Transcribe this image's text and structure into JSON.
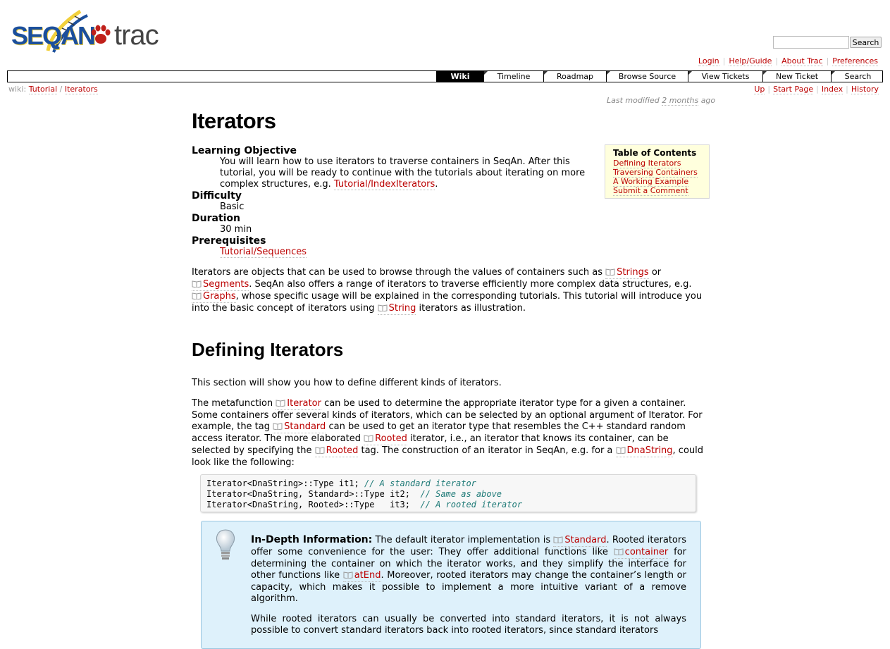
{
  "logo": {
    "brand": "SEQAN",
    "product": "trac"
  },
  "search": {
    "placeholder": "",
    "button": "Search"
  },
  "metanav": [
    "Login",
    "Help/Guide",
    "About Trac",
    "Preferences"
  ],
  "mainnav": [
    "Wiki",
    "Timeline",
    "Roadmap",
    "Browse Source",
    "View Tickets",
    "New Ticket",
    "Search"
  ],
  "breadcrumb": {
    "prefix": "wiki:",
    "items": [
      "Tutorial",
      "Iterators"
    ],
    "sep": "/"
  },
  "ctxtnav": [
    "Up",
    "Start Page",
    "Index",
    "History"
  ],
  "lastmod": {
    "prefix": "Last modified",
    "age": "2 months",
    "suffix": "ago"
  },
  "page": {
    "title": "Iterators",
    "definitions": [
      {
        "term": "Learning Objective",
        "text_before": "You will learn how to use iterators to traverse containers in SeqAn. After this tutorial, you will be ready to continue with the tutorials about iterating on more complex structures, e.g.",
        "link": "Tutorial/IndexIterators",
        "text_after": "."
      },
      {
        "term": "Difficulty",
        "text": "Basic"
      },
      {
        "term": "Duration",
        "text": "30 min"
      },
      {
        "term": "Prerequisites",
        "link": "Tutorial/Sequences"
      }
    ],
    "toc": {
      "title": "Table of Contents",
      "items": [
        "Defining Iterators",
        "Traversing Containers",
        "A Working Example",
        "Submit a Comment"
      ]
    },
    "intro": {
      "t1": "Iterators are objects that can be used to browse through the values of containers such as",
      "l1": "Strings",
      "t2": "or",
      "l2": "Segments",
      "t3": ". SeqAn also offers a range of iterators to traverse efficiently more complex data structures, e.g.",
      "l3": "Graphs",
      "t4": ", whose specific usage will be explained in the corresponding tutorials. This tutorial will introduce you into the basic concept of iterators using",
      "l4": "String",
      "t5": "iterators as illustration."
    },
    "section_title": "Defining Iterators",
    "section_intro": "This section will show you how to define different kinds of iterators.",
    "meta": {
      "t1": "The metafunction",
      "l1": "Iterator",
      "t2": "can be used to determine the appropriate iterator type for a given a container. Some containers offer several kinds of iterators, which can be selected by an optional argument of Iterator. For example, the tag",
      "l2": "Standard",
      "t3": "can be used to get an iterator type that resembles the C++ standard random access iterator. The more elaborated",
      "l3": "Rooted",
      "t4": "iterator, i.e., an iterator that knows its container, can be selected by specifying the",
      "l4": "Rooted",
      "t5": "tag. The construction of an iterator in SeqAn, e.g. for a",
      "l5": "DnaString",
      "t6": ", could look like the following:"
    },
    "code": [
      {
        "code": "Iterator<DnaString>::Type it1; ",
        "comment": "// A standard iterator"
      },
      {
        "code": "Iterator<DnaString, Standard>::Type it2;  ",
        "comment": "// Same as above"
      },
      {
        "code": "Iterator<DnaString, Rooted>::Type   it3;  ",
        "comment": "// A rooted iterator"
      }
    ],
    "info": {
      "heading": "In-Depth Information:",
      "t1": "The default iterator implementation is",
      "l1": "Standard",
      "t2": ". Rooted iterators offer some convenience for the user: They offer additional functions like",
      "l2": "container",
      "t3": "for determining the container on which the iterator works, and they simplify the interface for other functions like",
      "l3": "atEnd",
      "t4": ". Moreover, rooted iterators may change the container’s length or capacity, which makes it possible to implement a more intuitive variant of a remove algorithm.",
      "p2": "While rooted iterators can usually be converted into standard iterators, it is not always possible to convert standard iterators back into rooted iterators, since standard iterators"
    }
  }
}
